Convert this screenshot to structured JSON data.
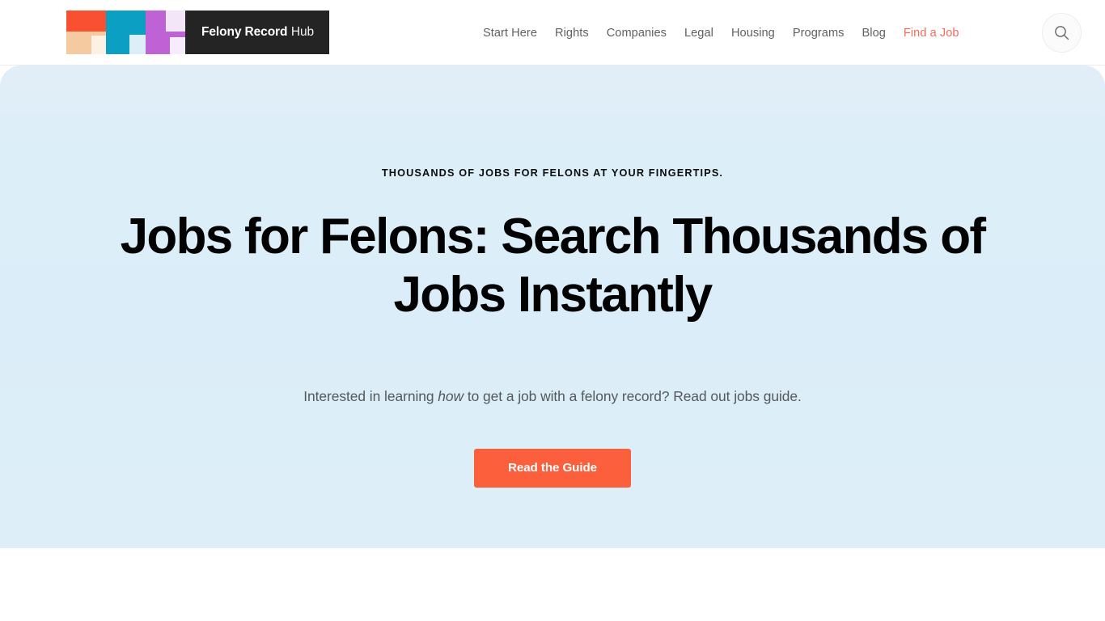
{
  "header": {
    "brand": {
      "logo_icon": "felony-record-hub-logo-mark",
      "name_strong": "Felony Record",
      "name_light": "Hub",
      "tiles": [
        {
          "letter": "f",
          "colors": [
            "#fa5032",
            "#f6caa0",
            "#fdf1e4"
          ]
        },
        {
          "letter": "r",
          "colors": [
            "#0b9fc4",
            "#0b9fc4",
            "#dceef7"
          ]
        },
        {
          "letter": "h",
          "colors": [
            "#bf62d6",
            "#f3e6f8",
            "#f7ecfb"
          ]
        }
      ]
    },
    "nav": [
      {
        "label": "Start Here",
        "accent": false
      },
      {
        "label": "Rights",
        "accent": false
      },
      {
        "label": "Companies",
        "accent": false
      },
      {
        "label": "Legal",
        "accent": false
      },
      {
        "label": "Housing",
        "accent": false
      },
      {
        "label": "Programs",
        "accent": false
      },
      {
        "label": "Blog",
        "accent": false
      },
      {
        "label": "Find a Job",
        "accent": true
      }
    ],
    "search": {
      "icon": "search-icon",
      "aria_label": "Search"
    }
  },
  "hero": {
    "eyebrow": "THOUSANDS OF JOBS FOR FELONS AT YOUR FINGERTIPS.",
    "title": "Jobs for Felons: Search Thousands of Jobs Instantly",
    "subtitle_before": "Interested in learning ",
    "subtitle_em": "how",
    "subtitle_after": " to get a job with a felony record? Read out jobs guide.",
    "cta_label": "Read the Guide"
  },
  "colors": {
    "accent": "#f76a5a",
    "cta": "#fb5f3c",
    "hero_bg": "#dcedf8",
    "logo_dark": "#242424",
    "nav_text": "#5e6163"
  }
}
